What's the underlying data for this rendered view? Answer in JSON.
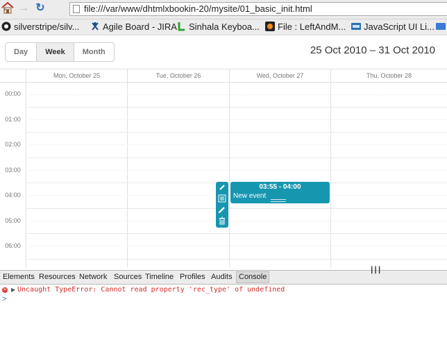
{
  "browser": {
    "url": "file:///var/www/dhtmlxbookin-20/mysite/01_basic_init.html",
    "nav": {
      "back": "←",
      "forward": "→",
      "reload": "↻"
    },
    "bookmarks": [
      {
        "label": "silverstripe/silv...",
        "icon": "github-icon"
      },
      {
        "label": "Agile Board - JIRA",
        "icon": "jira-icon"
      },
      {
        "label": "Sinhala Keyboa...",
        "icon": "l-letter-icon"
      },
      {
        "label": "File : LeftAndM...",
        "icon": "circle-logo-icon"
      },
      {
        "label": "JavaScript UI Li...",
        "icon": "dhtmlx-icon"
      },
      {
        "label": "",
        "icon": "overflow-icon"
      }
    ]
  },
  "scheduler": {
    "tabs": [
      {
        "label": "Day",
        "active": false
      },
      {
        "label": "Week",
        "active": true
      },
      {
        "label": "Month",
        "active": false
      }
    ],
    "date_range": "25 Oct 2010 – 31 Oct 2010",
    "days": [
      "Mon, October 25",
      "Tue, October 26",
      "Wed, October 27",
      "Thu, October 28"
    ],
    "hours": [
      "00:00",
      "01:00",
      "02:00",
      "03:00",
      "04:00",
      "05:00",
      "06:00"
    ],
    "event": {
      "time": "03:55 - 04:00",
      "text": "New event",
      "color": "#1796b0"
    },
    "event_menu": [
      "select-icon",
      "details-icon",
      "edit-icon",
      "delete-icon"
    ]
  },
  "devtools": {
    "tabs": [
      "Elements",
      "Resources",
      "Network",
      "Sources",
      "Timeline",
      "Profiles",
      "Audits",
      "Console"
    ],
    "active_tab": "Console",
    "error": "Uncaught TypeError: Cannot read property 'rec_type' of undefined",
    "prompt": ">"
  }
}
